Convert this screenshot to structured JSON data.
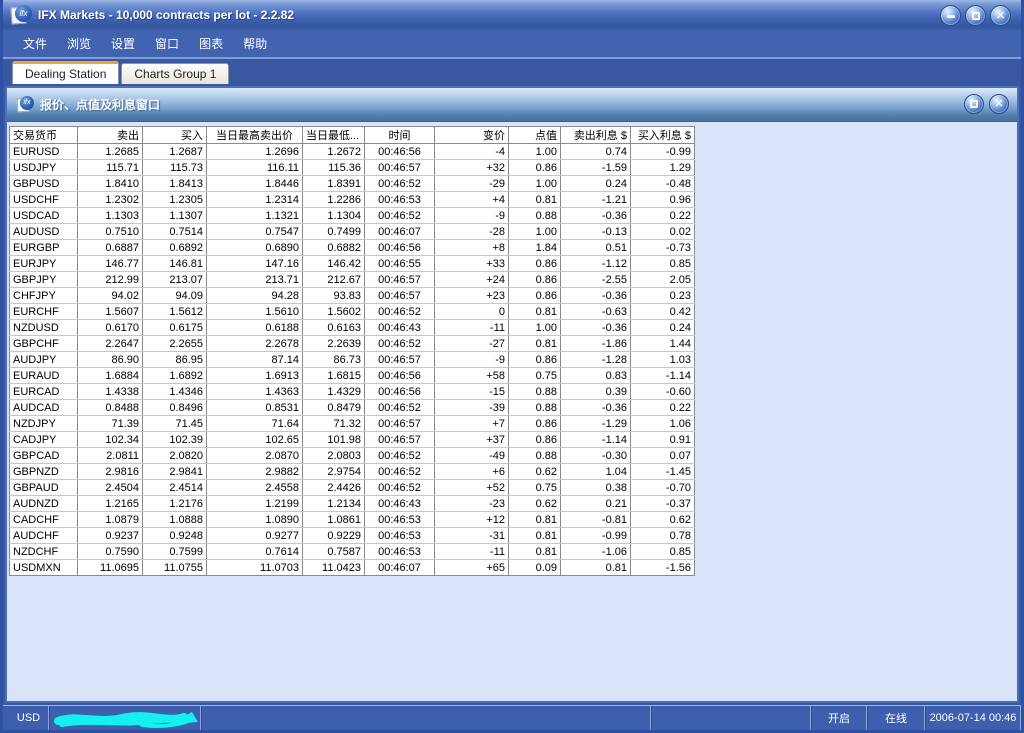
{
  "window": {
    "title": "IFX Markets - 10,000 contracts per lot - 2.2.82",
    "logo_text": "ifx"
  },
  "menu": {
    "items": [
      "文件",
      "浏览",
      "设置",
      "窗口",
      "图表",
      "帮助"
    ]
  },
  "tabs": [
    {
      "label": "Dealing Station",
      "active": true
    },
    {
      "label": "Charts Group 1",
      "active": false
    }
  ],
  "quote_window": {
    "title": "报价、点值及利息窗口",
    "logo_text": "ifx"
  },
  "quotes_table": {
    "columns": [
      "交易货币",
      "卖出",
      "买入",
      "当日最高卖出价",
      "当日最低...",
      "时间",
      "变价",
      "点值",
      "卖出利息 $",
      "买入利息 $"
    ],
    "rows": [
      {
        "pair": "EURUSD",
        "sell": "1.2685",
        "buy": "1.2687",
        "high": "1.2696",
        "low": "1.2672",
        "time": "00:46:56",
        "change": "-4",
        "point_value": "1.00",
        "sell_interest": "0.74",
        "buy_interest": "-0.99",
        "highlight": true
      },
      {
        "pair": "USDJPY",
        "sell": "115.71",
        "buy": "115.73",
        "high": "116.11",
        "low": "115.36",
        "time": "00:46:57",
        "change": "+32",
        "point_value": "0.86",
        "sell_interest": "-1.59",
        "buy_interest": "1.29",
        "highlight": true
      },
      {
        "pair": "GBPUSD",
        "sell": "1.8410",
        "buy": "1.8413",
        "high": "1.8446",
        "low": "1.8391",
        "time": "00:46:52",
        "change": "-29",
        "point_value": "1.00",
        "sell_interest": "0.24",
        "buy_interest": "-0.48",
        "highlight": false
      },
      {
        "pair": "USDCHF",
        "sell": "1.2302",
        "buy": "1.2305",
        "high": "1.2314",
        "low": "1.2286",
        "time": "00:46:53",
        "change": "+4",
        "point_value": "0.81",
        "sell_interest": "-1.21",
        "buy_interest": "0.96",
        "highlight": false
      },
      {
        "pair": "USDCAD",
        "sell": "1.1303",
        "buy": "1.1307",
        "high": "1.1321",
        "low": "1.1304",
        "time": "00:46:52",
        "change": "-9",
        "point_value": "0.88",
        "sell_interest": "-0.36",
        "buy_interest": "0.22",
        "highlight": false
      },
      {
        "pair": "AUDUSD",
        "sell": "0.7510",
        "buy": "0.7514",
        "high": "0.7547",
        "low": "0.7499",
        "time": "00:46:07",
        "change": "-28",
        "point_value": "1.00",
        "sell_interest": "-0.13",
        "buy_interest": "0.02",
        "highlight": false
      },
      {
        "pair": "EURGBP",
        "sell": "0.6887",
        "buy": "0.6892",
        "high": "0.6890",
        "low": "0.6882",
        "time": "00:46:56",
        "change": "+8",
        "point_value": "1.84",
        "sell_interest": "0.51",
        "buy_interest": "-0.73",
        "highlight": false
      },
      {
        "pair": "EURJPY",
        "sell": "146.77",
        "buy": "146.81",
        "high": "147.16",
        "low": "146.42",
        "time": "00:46:55",
        "change": "+33",
        "point_value": "0.86",
        "sell_interest": "-1.12",
        "buy_interest": "0.85",
        "highlight": true
      },
      {
        "pair": "GBPJPY",
        "sell": "212.99",
        "buy": "213.07",
        "high": "213.71",
        "low": "212.67",
        "time": "00:46:57",
        "change": "+24",
        "point_value": "0.86",
        "sell_interest": "-2.55",
        "buy_interest": "2.05",
        "highlight": true
      },
      {
        "pair": "CHFJPY",
        "sell": "94.02",
        "buy": "94.09",
        "high": "94.28",
        "low": "93.83",
        "time": "00:46:57",
        "change": "+23",
        "point_value": "0.86",
        "sell_interest": "-0.36",
        "buy_interest": "0.23",
        "highlight": true
      },
      {
        "pair": "EURCHF",
        "sell": "1.5607",
        "buy": "1.5612",
        "high": "1.5610",
        "low": "1.5602",
        "time": "00:46:52",
        "change": "0",
        "point_value": "0.81",
        "sell_interest": "-0.63",
        "buy_interest": "0.42",
        "highlight": false
      },
      {
        "pair": "NZDUSD",
        "sell": "0.6170",
        "buy": "0.6175",
        "high": "0.6188",
        "low": "0.6163",
        "time": "00:46:43",
        "change": "-11",
        "point_value": "1.00",
        "sell_interest": "-0.36",
        "buy_interest": "0.24",
        "highlight": false
      },
      {
        "pair": "GBPCHF",
        "sell": "2.2647",
        "buy": "2.2655",
        "high": "2.2678",
        "low": "2.2639",
        "time": "00:46:52",
        "change": "-27",
        "point_value": "0.81",
        "sell_interest": "-1.86",
        "buy_interest": "1.44",
        "highlight": false
      },
      {
        "pair": "AUDJPY",
        "sell": "86.90",
        "buy": "86.95",
        "high": "87.14",
        "low": "86.73",
        "time": "00:46:57",
        "change": "-9",
        "point_value": "0.86",
        "sell_interest": "-1.28",
        "buy_interest": "1.03",
        "highlight": false
      },
      {
        "pair": "EURAUD",
        "sell": "1.6884",
        "buy": "1.6892",
        "high": "1.6913",
        "low": "1.6815",
        "time": "00:46:56",
        "change": "+58",
        "point_value": "0.75",
        "sell_interest": "0.83",
        "buy_interest": "-1.14",
        "highlight": true
      },
      {
        "pair": "EURCAD",
        "sell": "1.4338",
        "buy": "1.4346",
        "high": "1.4363",
        "low": "1.4329",
        "time": "00:46:56",
        "change": "-15",
        "point_value": "0.88",
        "sell_interest": "0.39",
        "buy_interest": "-0.60",
        "highlight": true
      },
      {
        "pair": "AUDCAD",
        "sell": "0.8488",
        "buy": "0.8496",
        "high": "0.8531",
        "low": "0.8479",
        "time": "00:46:52",
        "change": "-39",
        "point_value": "0.88",
        "sell_interest": "-0.36",
        "buy_interest": "0.22",
        "highlight": false
      },
      {
        "pair": "NZDJPY",
        "sell": "71.39",
        "buy": "71.45",
        "high": "71.64",
        "low": "71.32",
        "time": "00:46:57",
        "change": "+7",
        "point_value": "0.86",
        "sell_interest": "-1.29",
        "buy_interest": "1.06",
        "highlight": false
      },
      {
        "pair": "CADJPY",
        "sell": "102.34",
        "buy": "102.39",
        "high": "102.65",
        "low": "101.98",
        "time": "00:46:57",
        "change": "+37",
        "point_value": "0.86",
        "sell_interest": "-1.14",
        "buy_interest": "0.91",
        "highlight": true
      },
      {
        "pair": "GBPCAD",
        "sell": "2.0811",
        "buy": "2.0820",
        "high": "2.0870",
        "low": "2.0803",
        "time": "00:46:52",
        "change": "-49",
        "point_value": "0.88",
        "sell_interest": "-0.30",
        "buy_interest": "0.07",
        "highlight": false
      },
      {
        "pair": "GBPNZD",
        "sell": "2.9816",
        "buy": "2.9841",
        "high": "2.9882",
        "low": "2.9754",
        "time": "00:46:52",
        "change": "+6",
        "point_value": "0.62",
        "sell_interest": "1.04",
        "buy_interest": "-1.45",
        "highlight": false
      },
      {
        "pair": "GBPAUD",
        "sell": "2.4504",
        "buy": "2.4514",
        "high": "2.4558",
        "low": "2.4426",
        "time": "00:46:52",
        "change": "+52",
        "point_value": "0.75",
        "sell_interest": "0.38",
        "buy_interest": "-0.70",
        "highlight": false
      },
      {
        "pair": "AUDNZD",
        "sell": "1.2165",
        "buy": "1.2176",
        "high": "1.2199",
        "low": "1.2134",
        "time": "00:46:43",
        "change": "-23",
        "point_value": "0.62",
        "sell_interest": "0.21",
        "buy_interest": "-0.37",
        "highlight": false
      },
      {
        "pair": "CADCHF",
        "sell": "1.0879",
        "buy": "1.0888",
        "high": "1.0890",
        "low": "1.0861",
        "time": "00:46:53",
        "change": "+12",
        "point_value": "0.81",
        "sell_interest": "-0.81",
        "buy_interest": "0.62",
        "highlight": false
      },
      {
        "pair": "AUDCHF",
        "sell": "0.9237",
        "buy": "0.9248",
        "high": "0.9277",
        "low": "0.9229",
        "time": "00:46:53",
        "change": "-31",
        "point_value": "0.81",
        "sell_interest": "-0.99",
        "buy_interest": "0.78",
        "highlight": false
      },
      {
        "pair": "NZDCHF",
        "sell": "0.7590",
        "buy": "0.7599",
        "high": "0.7614",
        "low": "0.7587",
        "time": "00:46:53",
        "change": "-11",
        "point_value": "0.81",
        "sell_interest": "-1.06",
        "buy_interest": "0.85",
        "highlight": false
      },
      {
        "pair": "USDMXN",
        "sell": "11.0695",
        "buy": "11.0755",
        "high": "11.0703",
        "low": "11.0423",
        "time": "00:46:07",
        "change": "+65",
        "point_value": "0.09",
        "sell_interest": "0.81",
        "buy_interest": "-1.56",
        "highlight": false
      }
    ]
  },
  "status_bar": {
    "currency": "USD",
    "open_label": "开启",
    "online_label": "在线",
    "datetime": "2006-07-14 00:46"
  },
  "colors": {
    "accent_orange": "#f0a23c",
    "quote_blue": "#0000d0",
    "down_red": "#e80000",
    "up_blue": "#0000e8",
    "redaction_cyan": "#14f0f0"
  }
}
